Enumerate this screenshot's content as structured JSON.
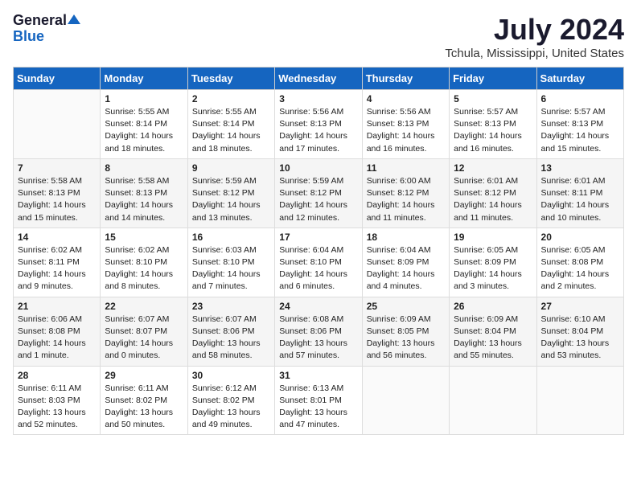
{
  "header": {
    "logo_general": "General",
    "logo_blue": "Blue",
    "title": "July 2024",
    "location": "Tchula, Mississippi, United States"
  },
  "days_of_week": [
    "Sunday",
    "Monday",
    "Tuesday",
    "Wednesday",
    "Thursday",
    "Friday",
    "Saturday"
  ],
  "weeks": [
    [
      {
        "day": "",
        "content": ""
      },
      {
        "day": "1",
        "content": "Sunrise: 5:55 AM\nSunset: 8:14 PM\nDaylight: 14 hours\nand 18 minutes."
      },
      {
        "day": "2",
        "content": "Sunrise: 5:55 AM\nSunset: 8:14 PM\nDaylight: 14 hours\nand 18 minutes."
      },
      {
        "day": "3",
        "content": "Sunrise: 5:56 AM\nSunset: 8:13 PM\nDaylight: 14 hours\nand 17 minutes."
      },
      {
        "day": "4",
        "content": "Sunrise: 5:56 AM\nSunset: 8:13 PM\nDaylight: 14 hours\nand 16 minutes."
      },
      {
        "day": "5",
        "content": "Sunrise: 5:57 AM\nSunset: 8:13 PM\nDaylight: 14 hours\nand 16 minutes."
      },
      {
        "day": "6",
        "content": "Sunrise: 5:57 AM\nSunset: 8:13 PM\nDaylight: 14 hours\nand 15 minutes."
      }
    ],
    [
      {
        "day": "7",
        "content": "Sunrise: 5:58 AM\nSunset: 8:13 PM\nDaylight: 14 hours\nand 15 minutes."
      },
      {
        "day": "8",
        "content": "Sunrise: 5:58 AM\nSunset: 8:13 PM\nDaylight: 14 hours\nand 14 minutes."
      },
      {
        "day": "9",
        "content": "Sunrise: 5:59 AM\nSunset: 8:12 PM\nDaylight: 14 hours\nand 13 minutes."
      },
      {
        "day": "10",
        "content": "Sunrise: 5:59 AM\nSunset: 8:12 PM\nDaylight: 14 hours\nand 12 minutes."
      },
      {
        "day": "11",
        "content": "Sunrise: 6:00 AM\nSunset: 8:12 PM\nDaylight: 14 hours\nand 11 minutes."
      },
      {
        "day": "12",
        "content": "Sunrise: 6:01 AM\nSunset: 8:12 PM\nDaylight: 14 hours\nand 11 minutes."
      },
      {
        "day": "13",
        "content": "Sunrise: 6:01 AM\nSunset: 8:11 PM\nDaylight: 14 hours\nand 10 minutes."
      }
    ],
    [
      {
        "day": "14",
        "content": "Sunrise: 6:02 AM\nSunset: 8:11 PM\nDaylight: 14 hours\nand 9 minutes."
      },
      {
        "day": "15",
        "content": "Sunrise: 6:02 AM\nSunset: 8:10 PM\nDaylight: 14 hours\nand 8 minutes."
      },
      {
        "day": "16",
        "content": "Sunrise: 6:03 AM\nSunset: 8:10 PM\nDaylight: 14 hours\nand 7 minutes."
      },
      {
        "day": "17",
        "content": "Sunrise: 6:04 AM\nSunset: 8:10 PM\nDaylight: 14 hours\nand 6 minutes."
      },
      {
        "day": "18",
        "content": "Sunrise: 6:04 AM\nSunset: 8:09 PM\nDaylight: 14 hours\nand 4 minutes."
      },
      {
        "day": "19",
        "content": "Sunrise: 6:05 AM\nSunset: 8:09 PM\nDaylight: 14 hours\nand 3 minutes."
      },
      {
        "day": "20",
        "content": "Sunrise: 6:05 AM\nSunset: 8:08 PM\nDaylight: 14 hours\nand 2 minutes."
      }
    ],
    [
      {
        "day": "21",
        "content": "Sunrise: 6:06 AM\nSunset: 8:08 PM\nDaylight: 14 hours\nand 1 minute."
      },
      {
        "day": "22",
        "content": "Sunrise: 6:07 AM\nSunset: 8:07 PM\nDaylight: 14 hours\nand 0 minutes."
      },
      {
        "day": "23",
        "content": "Sunrise: 6:07 AM\nSunset: 8:06 PM\nDaylight: 13 hours\nand 58 minutes."
      },
      {
        "day": "24",
        "content": "Sunrise: 6:08 AM\nSunset: 8:06 PM\nDaylight: 13 hours\nand 57 minutes."
      },
      {
        "day": "25",
        "content": "Sunrise: 6:09 AM\nSunset: 8:05 PM\nDaylight: 13 hours\nand 56 minutes."
      },
      {
        "day": "26",
        "content": "Sunrise: 6:09 AM\nSunset: 8:04 PM\nDaylight: 13 hours\nand 55 minutes."
      },
      {
        "day": "27",
        "content": "Sunrise: 6:10 AM\nSunset: 8:04 PM\nDaylight: 13 hours\nand 53 minutes."
      }
    ],
    [
      {
        "day": "28",
        "content": "Sunrise: 6:11 AM\nSunset: 8:03 PM\nDaylight: 13 hours\nand 52 minutes."
      },
      {
        "day": "29",
        "content": "Sunrise: 6:11 AM\nSunset: 8:02 PM\nDaylight: 13 hours\nand 50 minutes."
      },
      {
        "day": "30",
        "content": "Sunrise: 6:12 AM\nSunset: 8:02 PM\nDaylight: 13 hours\nand 49 minutes."
      },
      {
        "day": "31",
        "content": "Sunrise: 6:13 AM\nSunset: 8:01 PM\nDaylight: 13 hours\nand 47 minutes."
      },
      {
        "day": "",
        "content": ""
      },
      {
        "day": "",
        "content": ""
      },
      {
        "day": "",
        "content": ""
      }
    ]
  ]
}
